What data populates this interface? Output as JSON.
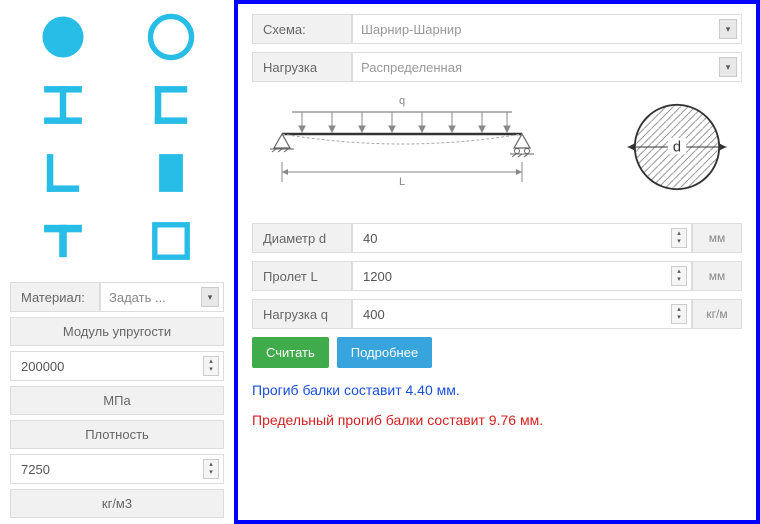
{
  "sidebar": {
    "material_label": "Материал:",
    "material_value": "Задать ...",
    "modulus_label": "Модуль упругости",
    "modulus_value": "200000",
    "modulus_unit": "МПа",
    "density_label": "Плотность",
    "density_value": "7250",
    "density_unit": "кг/м3"
  },
  "main": {
    "scheme_label": "Схема:",
    "scheme_value": "Шарнир-Шарнир",
    "load_type_label": "Нагрузка",
    "load_type_value": "Распределенная",
    "diameter_label": "Диаметр d",
    "diameter_value": "40",
    "diameter_unit": "мм",
    "span_label": "Пролет L",
    "span_value": "1200",
    "span_unit": "мм",
    "load_label": "Нагрузка q",
    "load_value": "400",
    "load_unit": "кг/м",
    "btn_calc": "Считать",
    "btn_more": "Подробнее",
    "result1": "Прогиб балки составит 4.40 мм.",
    "result2": "Предельный прогиб балки составит 9.76 мм."
  },
  "diagram": {
    "q": "q",
    "L": "L",
    "d": "d"
  }
}
